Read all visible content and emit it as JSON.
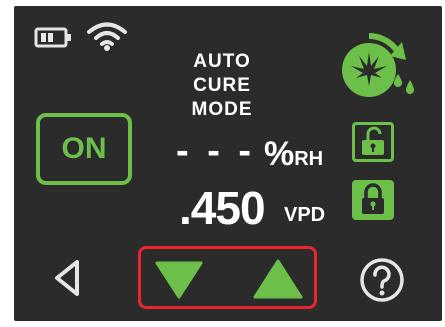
{
  "mode": {
    "title_line1": "AUTO CURE",
    "title_line2": "MODE"
  },
  "power": {
    "label": "ON"
  },
  "humidity": {
    "value": "- - -",
    "unit_main": "%",
    "unit_sub": "RH"
  },
  "vpd": {
    "value": ".450",
    "unit": "VPD"
  },
  "icons": {
    "battery": "battery-icon",
    "wifi": "wifi-icon",
    "cure_mode": "leaf-refresh-icon",
    "lock_open": "unlock-icon",
    "lock_closed": "lock-icon",
    "back": "back-triangle-icon",
    "down": "down-arrow-icon",
    "up": "up-arrow-icon",
    "help": "help-icon"
  },
  "colors": {
    "accent": "#6cc04a",
    "background": "#2b2b2b",
    "highlight": "#e8262f"
  }
}
